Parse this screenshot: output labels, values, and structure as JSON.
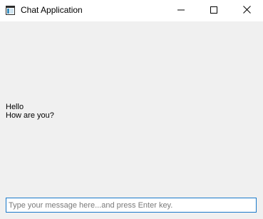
{
  "window": {
    "title": "Chat Application"
  },
  "titlebar": {
    "icons": {
      "app": "app-window-icon",
      "minimize": "minimize-icon",
      "maximize": "maximize-icon",
      "close": "close-icon"
    }
  },
  "chat": {
    "messages": [
      "Hello",
      "How are you?"
    ]
  },
  "input": {
    "value": "",
    "placeholder": "Type your message here...and press Enter key."
  },
  "colors": {
    "window_bg": "#f0f0f0",
    "titlebar_bg": "#ffffff",
    "input_border": "#1979ca",
    "placeholder": "#7a7a7a"
  }
}
